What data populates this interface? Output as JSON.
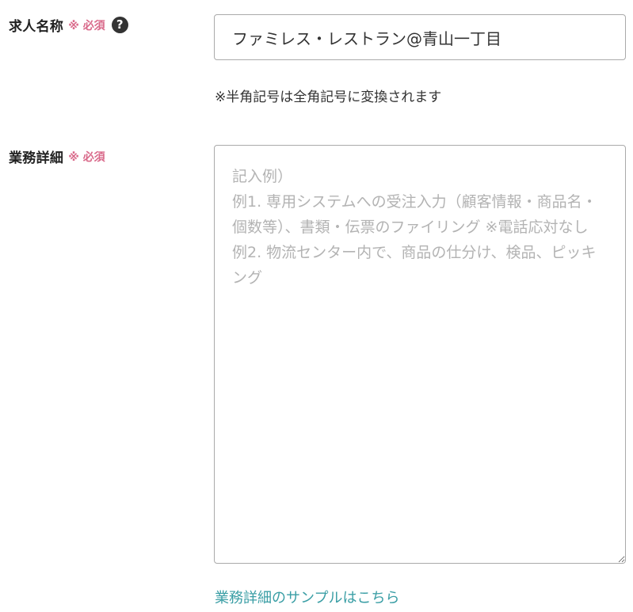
{
  "form": {
    "job_title": {
      "label": "求人名称",
      "required": "※ 必須",
      "help_icon_glyph": "?",
      "value": "ファミレス・レストラン@青山一丁目",
      "note": "※半角記号は全角記号に変換されます"
    },
    "job_details": {
      "label": "業務詳細",
      "required": "※ 必須",
      "placeholder": "記入例）\n例1. 専用システムへの受注入力（顧客情報・商品名・個数等）、書類・伝票のファイリング ※電話応対なし\n例2. 物流センター内で、商品の仕分け、検品、ピッキング",
      "sample_link": "業務詳細のサンプルはこちら"
    }
  },
  "colors": {
    "required": "#d9698a",
    "link": "#3a9ea5",
    "border": "#aaaaaa",
    "placeholder": "#b3b3b3"
  }
}
